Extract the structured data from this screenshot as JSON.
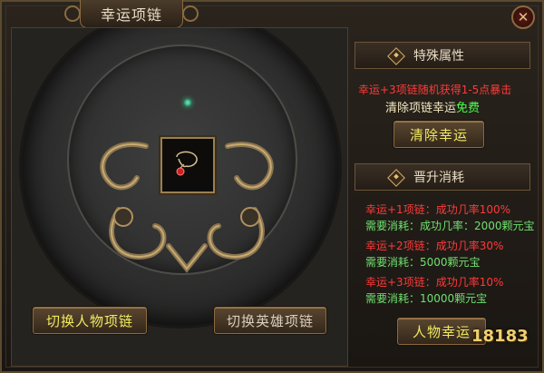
{
  "window": {
    "title": "幸运项链",
    "close_symbol": "✕"
  },
  "left": {
    "button_person": "切换人物项链",
    "button_hero": "切换英雄项链"
  },
  "special": {
    "heading": "特殊属性",
    "line1": "幸运+3项链随机获得1-5点暴击",
    "line2_prefix": "清除项链幸运",
    "line2_free": "免费",
    "button": "清除幸运"
  },
  "upgrade": {
    "heading": "晋升消耗",
    "rows": [
      {
        "title": "幸运+1项链：成功几率100%",
        "cost": "需要消耗：成功几率：2000颗元宝"
      },
      {
        "title": "幸运+2项链：成功几率30%",
        "cost": "需要消耗：5000颗元宝"
      },
      {
        "title": "幸运+3项链：成功几率10%",
        "cost": "需要消耗：10000颗元宝"
      }
    ],
    "button": "人物幸运"
  },
  "watermark": "18183",
  "colors": {
    "red": "#ff3a3a",
    "green": "#70e070",
    "gold": "#f0ea60"
  }
}
